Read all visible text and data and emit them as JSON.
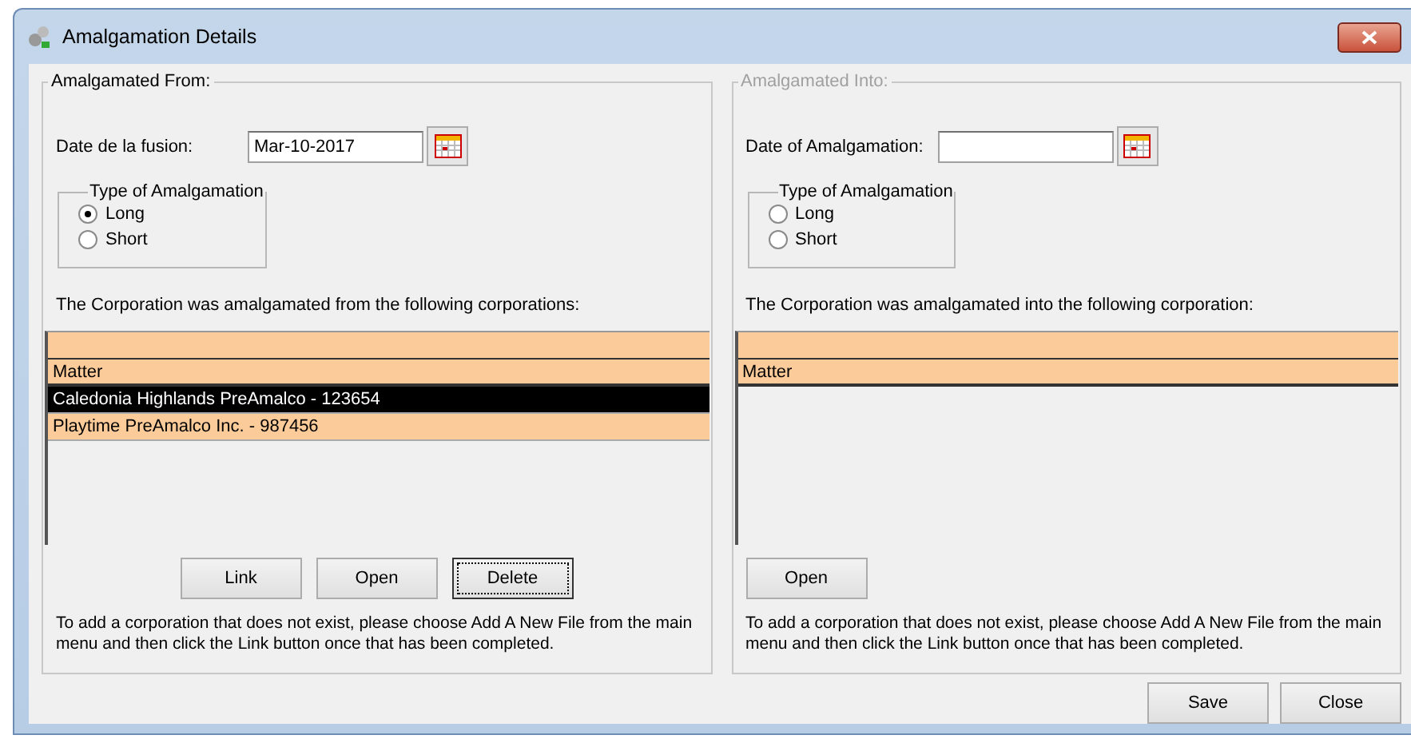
{
  "window": {
    "title": "Amalgamation Details"
  },
  "panels": [
    {
      "legend": "Amalgamated From:",
      "disabled": false,
      "date_label": "Date de la fusion:",
      "date_value": "Mar-10-2017",
      "type_group": {
        "title": "Type of Amalgamation",
        "options": [
          {
            "label": "Long",
            "selected": true
          },
          {
            "label": "Short",
            "selected": false
          }
        ]
      },
      "list_caption": "The Corporation was amalgamated from the following corporations:",
      "list": {
        "columns": [
          "Matter"
        ],
        "rows": [
          {
            "text": "Caledonia Highlands PreAmalco - 123654",
            "selected": true
          },
          {
            "text": "Playtime PreAmalco Inc. - 987456",
            "selected": false
          }
        ]
      },
      "buttons": [
        {
          "label": "Link",
          "focused": false
        },
        {
          "label": "Open",
          "focused": false
        },
        {
          "label": "Delete",
          "focused": true
        }
      ],
      "note": "To add a corporation that does not exist, please choose Add A New File from the main menu and then click the Link button once that has been completed."
    },
    {
      "legend": "Amalgamated Into:",
      "disabled": true,
      "date_label": "Date of Amalgamation:",
      "type_group": {
        "title": "Type of Amalgamation",
        "options": [
          {
            "label": "Long",
            "selected": false
          },
          {
            "label": "Short",
            "selected": false
          }
        ]
      },
      "list_caption": "The Corporation was amalgamated into the following corporation:",
      "list": {
        "columns": [
          "Matter"
        ]
      },
      "buttons": [
        {
          "label": "Open",
          "focused": false
        }
      ],
      "note": "To add a corporation that does not exist, please choose Add A New File from the main menu and then click the Link button once that has been completed."
    }
  ],
  "footer_buttons": [
    "Save",
    "Close"
  ]
}
